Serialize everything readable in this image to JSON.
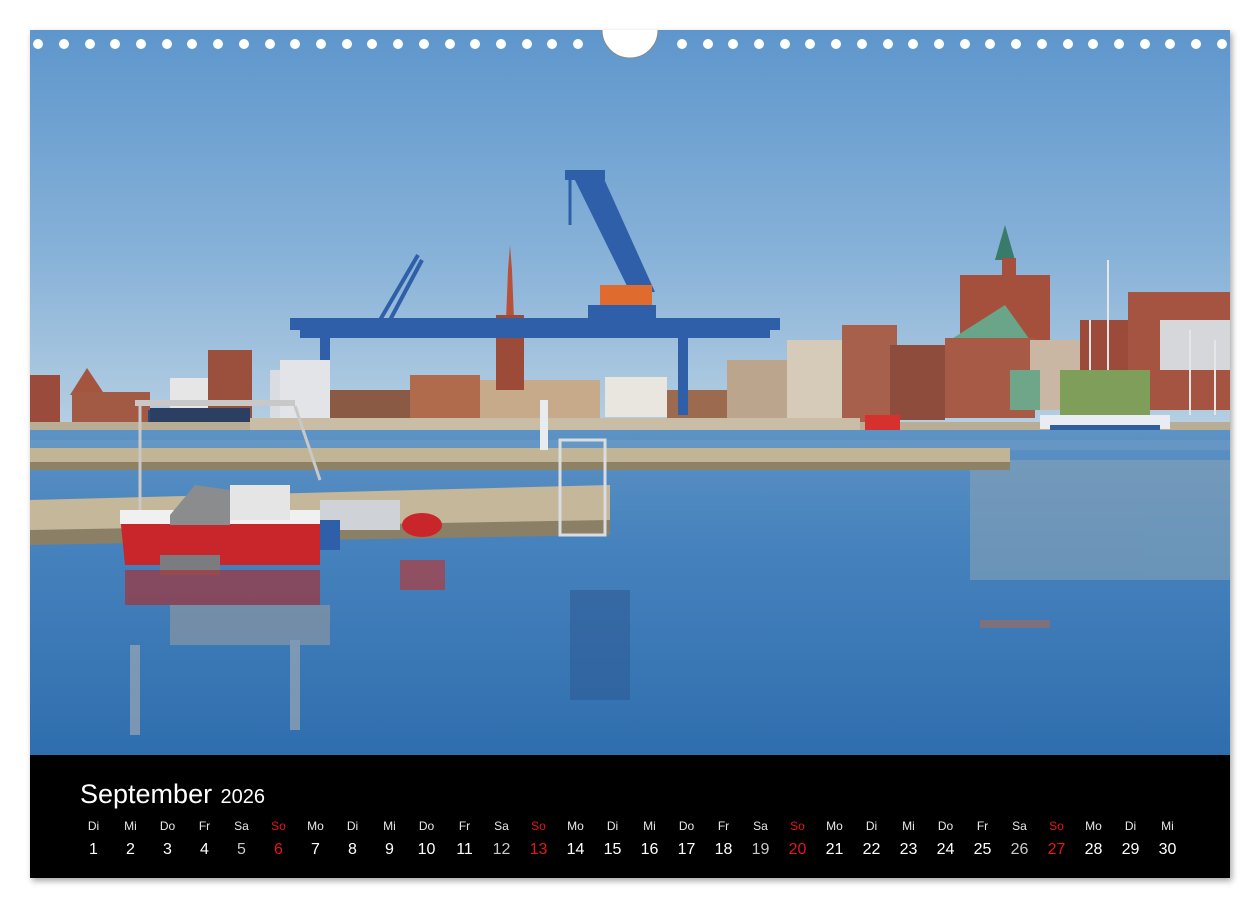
{
  "calendar": {
    "month": "September",
    "year": "2026",
    "days": [
      {
        "wd": "Di",
        "n": "1"
      },
      {
        "wd": "Mi",
        "n": "2"
      },
      {
        "wd": "Do",
        "n": "3"
      },
      {
        "wd": "Fr",
        "n": "4"
      },
      {
        "wd": "Sa",
        "n": "5"
      },
      {
        "wd": "So",
        "n": "6"
      },
      {
        "wd": "Mo",
        "n": "7"
      },
      {
        "wd": "Di",
        "n": "8"
      },
      {
        "wd": "Mi",
        "n": "9"
      },
      {
        "wd": "Do",
        "n": "10"
      },
      {
        "wd": "Fr",
        "n": "11"
      },
      {
        "wd": "Sa",
        "n": "12"
      },
      {
        "wd": "So",
        "n": "13"
      },
      {
        "wd": "Mo",
        "n": "14"
      },
      {
        "wd": "Di",
        "n": "15"
      },
      {
        "wd": "Mi",
        "n": "16"
      },
      {
        "wd": "Do",
        "n": "17"
      },
      {
        "wd": "Fr",
        "n": "18"
      },
      {
        "wd": "Sa",
        "n": "19"
      },
      {
        "wd": "So",
        "n": "20"
      },
      {
        "wd": "Mo",
        "n": "21"
      },
      {
        "wd": "Di",
        "n": "22"
      },
      {
        "wd": "Mi",
        "n": "23"
      },
      {
        "wd": "Do",
        "n": "24"
      },
      {
        "wd": "Fr",
        "n": "25"
      },
      {
        "wd": "Sa",
        "n": "26"
      },
      {
        "wd": "So",
        "n": "27"
      },
      {
        "wd": "Mo",
        "n": "28"
      },
      {
        "wd": "Di",
        "n": "29"
      },
      {
        "wd": "Mi",
        "n": "30"
      }
    ]
  },
  "colors": {
    "sky_top": "#5b93c9",
    "sky_bottom": "#b3cde0",
    "water": "#3a7bb8",
    "crane_blue": "#2f5fa8",
    "boat_red": "#c8262b",
    "calendar_bg": "#000000",
    "sunday_red": "#e8141b"
  }
}
